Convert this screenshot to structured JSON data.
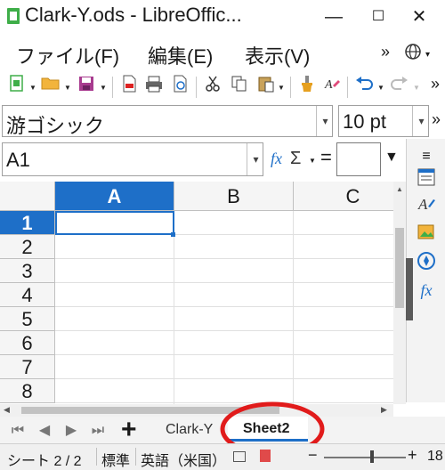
{
  "window": {
    "title": "Clark-Y.ods - LibreOffic...",
    "minimize": "—",
    "maximize": "☐",
    "close": "✕"
  },
  "menu": {
    "file": "ファイル(F)",
    "edit": "編集(E)",
    "view": "表示(V)",
    "overflow": "»"
  },
  "toolbar": {
    "overflow": "»"
  },
  "font": {
    "name": "游ゴシック",
    "size": "10 pt",
    "overflow": "»"
  },
  "formula": {
    "name_box": "A1",
    "fx": "fx",
    "sum": "Σ",
    "equals": "="
  },
  "grid": {
    "columns": [
      "A",
      "B",
      "C"
    ],
    "rows": [
      "1",
      "2",
      "3",
      "4",
      "5",
      "6",
      "7",
      "8"
    ],
    "selected_cell": "A1"
  },
  "sheets": {
    "tabs": [
      "Clark-Y",
      "Sheet2"
    ],
    "active": "Sheet2",
    "add": "+"
  },
  "status": {
    "sheet": "シート 2 / 2",
    "style": "標準",
    "language": "英語（米国）",
    "zoom": "18"
  },
  "colors": {
    "accent": "#1e6fc8",
    "highlight_circle": "#e11b1b",
    "calc_green": "#3fae49"
  }
}
